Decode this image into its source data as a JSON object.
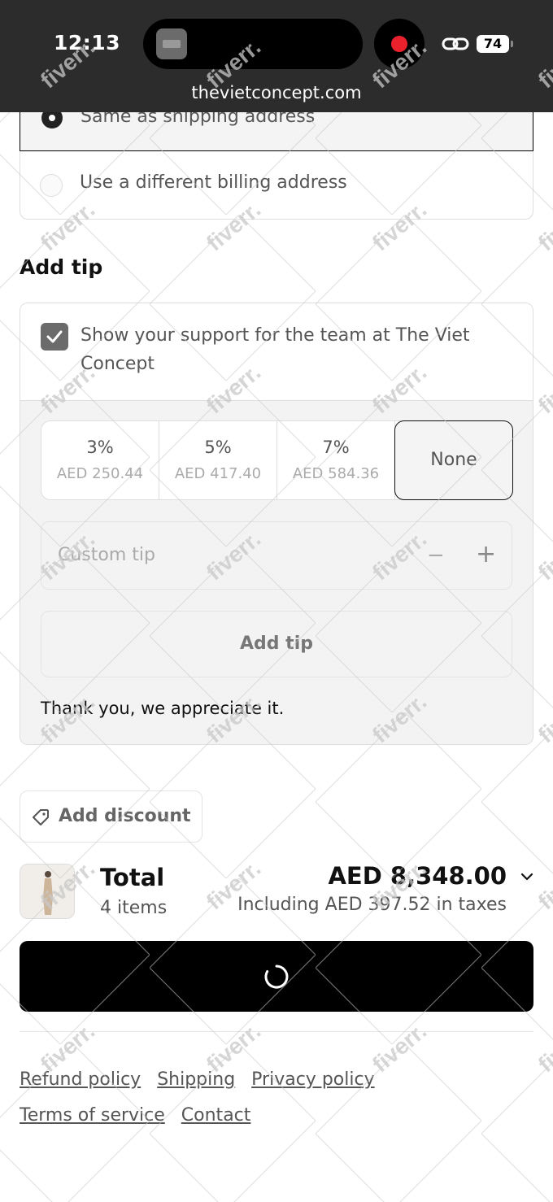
{
  "status_bar": {
    "time": "12:13",
    "battery": "74",
    "url": "thevietconcept.com"
  },
  "billing": {
    "option_same": "Same as shipping address",
    "option_different": "Use a different billing address"
  },
  "tip": {
    "heading": "Add tip",
    "support_label": "Show your support for the team at The Viet Concept",
    "options": [
      {
        "percent": "3%",
        "amount": "AED 250.44"
      },
      {
        "percent": "5%",
        "amount": "AED 417.40"
      },
      {
        "percent": "7%",
        "amount": "AED 584.36"
      }
    ],
    "none_label": "None",
    "custom_placeholder": "Custom tip",
    "add_button": "Add tip",
    "thanks": "Thank you, we appreciate it."
  },
  "discount": {
    "label": "Add discount"
  },
  "summary": {
    "total_label": "Total",
    "items": "4 items",
    "amount": "AED 8,348.00",
    "taxes": "Including AED 397.52 in taxes"
  },
  "footer": {
    "links": [
      "Refund policy",
      "Shipping",
      "Privacy policy",
      "Terms of service",
      "Contact"
    ]
  },
  "watermark_text": "fiverr."
}
